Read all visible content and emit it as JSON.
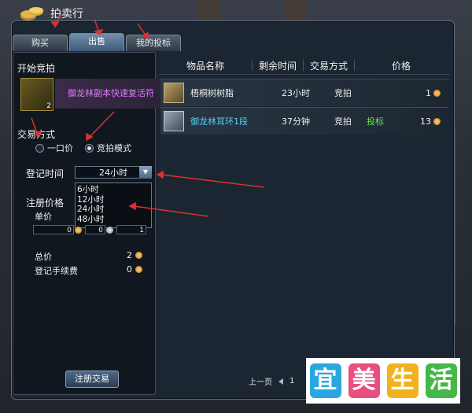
{
  "window": {
    "title": "拍卖行",
    "title_icon": "auction-coins-icon"
  },
  "tabs": [
    {
      "label": "购买",
      "active": false
    },
    {
      "label": "出售",
      "active": true
    },
    {
      "label": "我的投标",
      "active": false
    }
  ],
  "sell": {
    "section_title": "开始竞拍",
    "item_name": "御龙林副本快速复活符",
    "item_count": "2",
    "trade_mode_label": "交易方式",
    "mode_fixed": "一口价",
    "mode_auction": "竞拍模式",
    "selected_mode": "竞拍模式",
    "duration_label": "登记时间",
    "duration_value": "24小时",
    "duration_options": [
      "6小时",
      "12小时",
      "24小时",
      "48小时"
    ],
    "price_label": "注册价格",
    "unit_price_label": "单价",
    "unit_price_gold": "0",
    "unit_price_silver": "0",
    "unit_price_copper": "1",
    "total_label": "总价",
    "total_value": "2",
    "fee_label": "登记手续费",
    "fee_value": "0",
    "register_button": "注册交易"
  },
  "table": {
    "headers": [
      "物品名称",
      "剩余时间",
      "交易方式",
      "价格"
    ],
    "rows": [
      {
        "name": "梧桐树树脂",
        "time": "23小时",
        "mode": "竞拍",
        "tag": "",
        "price": "1",
        "name_color": "#f0f0f0"
      },
      {
        "name": "御龙林耳环1段",
        "time": "37分钟",
        "mode": "竞拍",
        "tag": "投标",
        "price": "13",
        "name_color": "#4fd0ff"
      }
    ]
  },
  "pager": {
    "prev": "上一页",
    "page": "1"
  },
  "watermark": {
    "chars": [
      "宜",
      "美",
      "生",
      "活"
    ],
    "colors": [
      "#2aa7e0",
      "#e84f7f",
      "#f2b21f",
      "#45b84a"
    ]
  }
}
